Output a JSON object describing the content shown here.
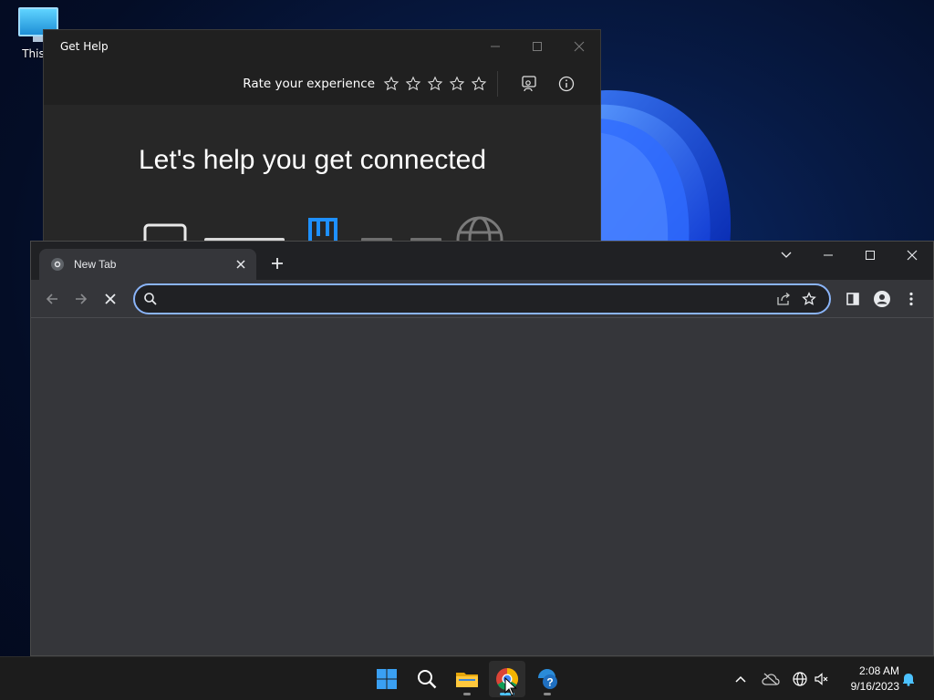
{
  "desktop": {
    "icons": [
      {
        "label": "This P"
      }
    ]
  },
  "get_help": {
    "title": "Get Help",
    "rate_label": "Rate your experience",
    "stars_total": 5,
    "heading": "Let's help you get connected"
  },
  "chrome": {
    "tab": {
      "title": "New Tab"
    },
    "omnibox": {
      "value": "",
      "placeholder": ""
    }
  },
  "taskbar": {
    "apps": [
      "start-icon",
      "search-icon",
      "file-explorer-icon",
      "chrome-icon",
      "get-help-icon"
    ],
    "active_app": "chrome-icon",
    "time": "2:08 AM",
    "date": "9/16/2023"
  },
  "colors": {
    "accent": "#8ab4f8",
    "taskbar_active": "#4cc2ff",
    "chrome_bg": "#35363a",
    "tabstrip_bg": "#202124"
  }
}
